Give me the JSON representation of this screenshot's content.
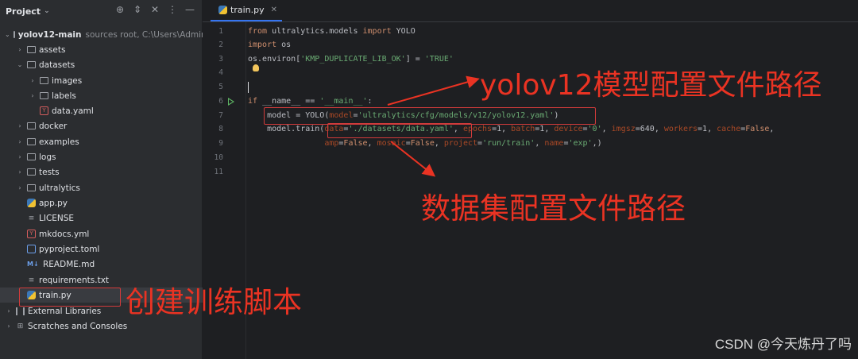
{
  "project_panel": {
    "title": "Project",
    "root": {
      "name": "yolov12-main",
      "hint": "sources root, C:\\Users\\Admini"
    },
    "items": [
      {
        "label": "assets"
      },
      {
        "label": "datasets"
      },
      {
        "label": "images"
      },
      {
        "label": "labels"
      },
      {
        "label": "data.yaml"
      },
      {
        "label": "docker"
      },
      {
        "label": "examples"
      },
      {
        "label": "logs"
      },
      {
        "label": "tests"
      },
      {
        "label": "ultralytics"
      },
      {
        "label": "app.py"
      },
      {
        "label": "LICENSE"
      },
      {
        "label": "mkdocs.yml"
      },
      {
        "label": "pyproject.toml"
      },
      {
        "label": "README.md"
      },
      {
        "label": "requirements.txt"
      },
      {
        "label": "train.py"
      },
      {
        "label": "External Libraries"
      },
      {
        "label": "Scratches and Consoles"
      }
    ],
    "icon_labels": {
      "md": "M↓",
      "yaml": "Y"
    }
  },
  "editor": {
    "tab": {
      "label": "train.py"
    },
    "line_numbers": [
      "1",
      "2",
      "3",
      "4",
      "5",
      "6",
      "7",
      "8",
      "9",
      "10",
      "11"
    ],
    "code": {
      "l1a": "from",
      "l1b": " ultralytics.models ",
      "l1c": "import",
      "l1d": " YOLO",
      "l2a": "import",
      "l2b": " os",
      "l3a": "os.environ[",
      "l3b": "'KMP_DUPLICATE_LIB_OK'",
      "l3c": "] = ",
      "l3d": "'TRUE'",
      "l6a": "if",
      "l6b": " __name__ == ",
      "l6c": "'__main__'",
      "l6d": ":",
      "l7a": "    model = YOLO(",
      "l7b": "model",
      "l7c": "=",
      "l7d": "'ultralytics/cfg/models/v12/yolov12.yaml'",
      "l7e": ")",
      "l8a": "    model.train(",
      "l8b": "data",
      "l8c": "=",
      "l8d": "'./datasets/data.yaml'",
      "l8e": ", ",
      "l8f": "epochs",
      "l8g": "=1, ",
      "l8h": "batch",
      "l8i": "=1, ",
      "l8j": "device",
      "l8k": "=",
      "l8l": "'0'",
      "l8m": ", ",
      "l8n": "imgsz",
      "l8o": "=640, ",
      "l8p": "workers",
      "l8q": "=1, ",
      "l8r": "cache",
      "l8s": "=",
      "l8t": "False",
      "l8u": ",",
      "l9a": "                ",
      "l9b": "amp",
      "l9c": "=",
      "l9d": "False",
      "l9e": ", ",
      "l9f": "mosaic",
      "l9g": "=",
      "l9h": "False",
      "l9i": ", ",
      "l9j": "project",
      "l9k": "=",
      "l9l": "'run/train'",
      "l9m": ", ",
      "l9n": "name",
      "l9o": "=",
      "l9p": "'exp'",
      "l9q": ",)"
    }
  },
  "annotations": {
    "model_config": "yolov12模型配置文件路径",
    "dataset_config": "数据集配置文件路径",
    "create_script": "创建训练脚本"
  },
  "watermark": "CSDN @今天炼丹了吗",
  "colors": {
    "annotation": "#ea3323",
    "keyword": "#cf8e6d",
    "string": "#6aab73",
    "param": "#aa4926"
  }
}
